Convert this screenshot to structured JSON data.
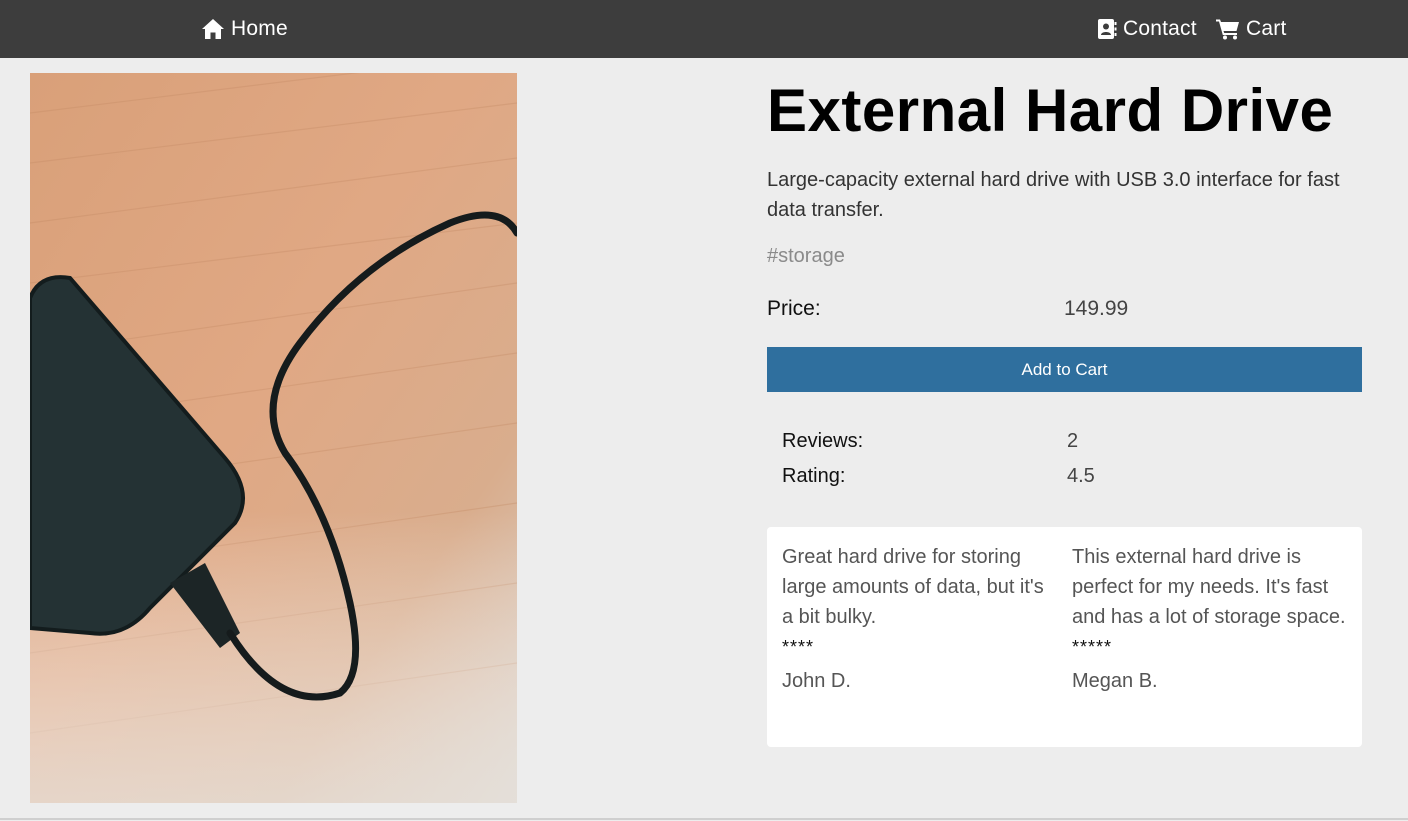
{
  "nav": {
    "home_label": "Home",
    "contact_label": "Contact",
    "cart_label": "Cart",
    "home_icon": "home-icon",
    "contact_icon": "contact-card-icon",
    "cart_icon": "shopping-cart-icon",
    "background_color": "#3d3d3d"
  },
  "product": {
    "title": "External Hard Drive",
    "description": "Large-capacity external hard drive with USB 3.0 interface for fast data transfer.",
    "tag": "#storage",
    "price_label": "Price:",
    "price_value": "149.99",
    "add_to_cart_label": "Add to Cart",
    "accent_color": "#2f6f9e"
  },
  "stats": {
    "reviews_label": "Reviews:",
    "reviews_value": "2",
    "rating_label": "Rating:",
    "rating_value": "4.5"
  },
  "reviews": [
    {
      "text": "Great hard drive for storing large amounts of data, but it's a bit bulky.",
      "stars": "****",
      "author": "John D."
    },
    {
      "text": "This external hard drive is perfect for my needs. It's fast and has a lot of storage space.",
      "stars": "*****",
      "author": "Megan B."
    }
  ]
}
